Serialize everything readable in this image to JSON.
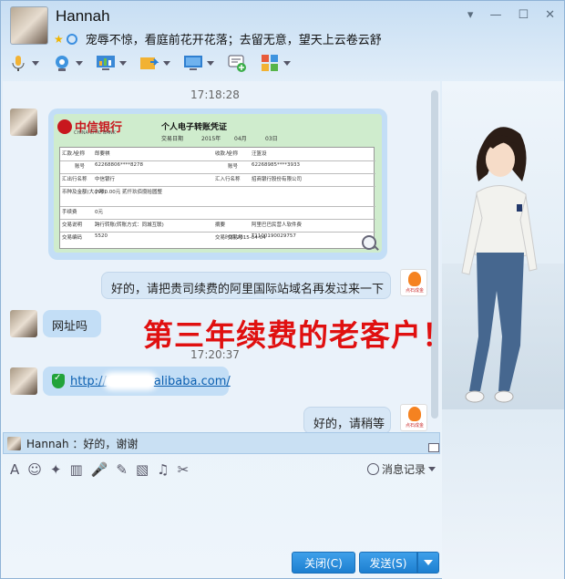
{
  "header": {
    "name": "Hannah",
    "signature": "宠辱不惊，看庭前花开花落；去留无意，望天上云卷云舒"
  },
  "window_controls": [
    "▾",
    "—",
    "☐",
    "✕"
  ],
  "toolbar": {
    "items": [
      "mic-icon",
      "video-icon",
      "screen-share-icon",
      "file-transfer-icon",
      "remote-desktop-icon",
      "add-friend-icon",
      "apps-icon"
    ]
  },
  "chat": {
    "times": [
      "17:18:28",
      "17:20:37"
    ],
    "receipt": {
      "bank_name": "中信银行",
      "bank_en": "CHINA CITIC BANK",
      "title": "个人电子转账凭证",
      "date_label": "交易日期",
      "year": "2015年",
      "month": "04月",
      "day": "03日",
      "rows": [
        [
          "汇款人",
          "全称",
          "郎要祺",
          "收款人",
          "全称",
          "汪篮设"
        ],
        [
          "",
          "账号",
          "62268806****8278",
          "",
          "账号",
          "62268985****3933"
        ],
        [
          "汇出行名称",
          "",
          "中信银行",
          "汇入行名称",
          "",
          "招商银行股份有限公司"
        ],
        [
          "币种及金额(大小写)",
          "",
          "2980.00元   贰仟玖佰捌拾圆整",
          "",
          "",
          ""
        ],
        [
          "手续费",
          "",
          "0元",
          "",
          "",
          ""
        ],
        [
          "交易说明",
          "",
          "跨行转账(转账方式：同城互联)",
          "摘要",
          "",
          "阿里巴巴民营人软件费"
        ],
        [
          "交易编码",
          "",
          "5520",
          "交易时间  2015-04-04",
          "交易号",
          "T1100190029757"
        ]
      ]
    },
    "msg_out_1": "好的，请把贵司续费的阿里国际站域名再发过来一下",
    "msg_in_2": "网址吗",
    "overlay_text": "第三年续费的老客户！",
    "link_prefix": "http://",
    "link_suffix": "alibaba.com/",
    "msg_out_2": "好的，请稍等",
    "logo_label": "点石成金"
  },
  "reply_preview": "Hannah ：好的，谢谢",
  "input_tools": [
    "A",
    "☺",
    "✦",
    "▥",
    "🎤",
    "✎",
    "▧",
    "♫",
    "✂"
  ],
  "history_label": "消息记录",
  "buttons": {
    "close": "关闭(C)",
    "send": "发送(S)"
  }
}
